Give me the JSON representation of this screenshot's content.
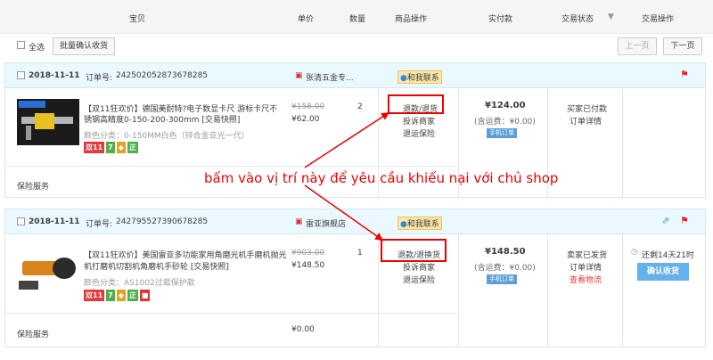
{
  "header": {
    "col_item": "宝贝",
    "col_price": "单价",
    "col_qty": "数量",
    "col_ops": "商品操作",
    "col_paid": "实付款",
    "col_status": "交易状态",
    "col_actions": "交易操作"
  },
  "toolbar": {
    "select_all": "全选",
    "batch_confirm": "批量确认收货",
    "prev_page": "上一页",
    "next_page": "下一页"
  },
  "orders": [
    {
      "date": "2018-11-11",
      "order_label": "订单号:",
      "order_no": "242502052873678285",
      "shop": "张清五金专...",
      "contact": "和我联系",
      "title": "【双11狂欢价】德国美耐特?电子数显卡尺 游标卡尺不锈钢高精度0-150-200-300mm [交易快照]",
      "title_line1": "【双11狂欢价】德国美耐特?电子数显卡尺 游标卡尺不",
      "title_line2": "锈钢高精度0-150-200-300mm [交易快照]",
      "variant": "颜色分类：0-150MM白色（锌合金亚光一代）",
      "orig_price": "¥158.00",
      "price": "¥62.00",
      "qty": "2",
      "op_refund": "退款/退货",
      "op_complain": "投诉商家",
      "op_insurance": "退运保险",
      "paid": "¥124.00",
      "shipping": "(含运费：¥0.00)",
      "phone_tag": "手机订单",
      "status": "买家已付款",
      "detail": "订单详情",
      "insurance_service": "保险服务"
    },
    {
      "date": "2018-11-11",
      "order_label": "订单号:",
      "order_no": "242795527390678285",
      "shop": "雷亚旗舰店",
      "contact": "和我联系",
      "title_line1": "【双11狂欢价】美国雷亚多功能家用角磨光机手磨机抛光",
      "title_line2": "机打磨机切割机角磨机手砂轮 [交易快照]",
      "variant": "颜色分类：AS1002过载保护款",
      "orig_price": "¥903.00",
      "price": "¥148.50",
      "qty": "1",
      "op_refund": "退款/退换货",
      "op_complain": "投诉商家",
      "op_insurance": "退运保险",
      "paid": "¥148.50",
      "shipping": "(含运费：¥0.00)",
      "phone_tag": "手机订单",
      "status": "卖家已发货",
      "detail": "订单详情",
      "logistics": "查看物流",
      "remaining": "还剩14天21时",
      "confirm": "确认收货",
      "insurance_service": "保险服务",
      "insurance_price": "¥0.00"
    }
  ],
  "annotation": "bấm vào vị trí này để yêu cầu khiếu nại với chủ shop",
  "colors": {
    "accent_red": "#e00000",
    "header_bg": "#f5f5f5",
    "order_head_bg": "#eaf8ff",
    "confirm_btn": "#65b1ec"
  }
}
